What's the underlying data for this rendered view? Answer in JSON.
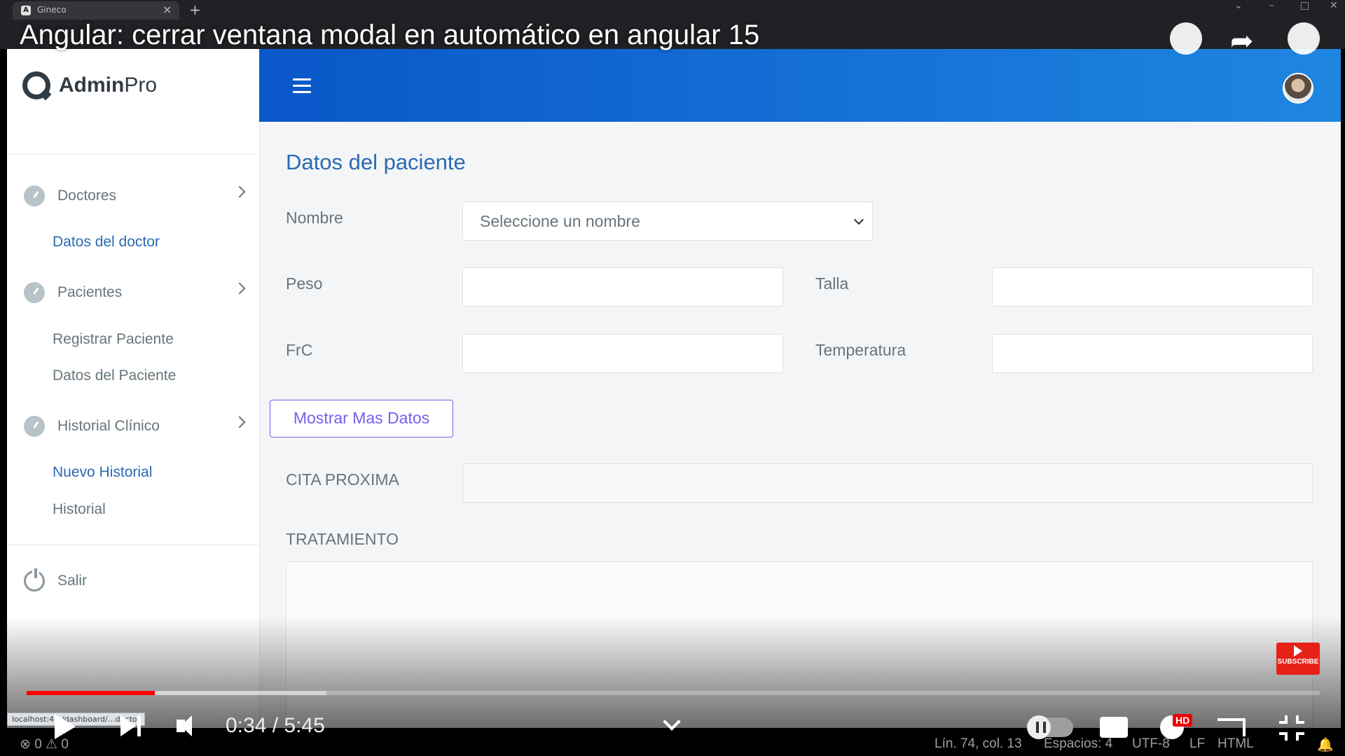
{
  "browser": {
    "tab_title": "Gineco",
    "tab_favicon": "A",
    "tab_close": "×",
    "new_tab": "+"
  },
  "video": {
    "title": "Angular: cerrar ventana modal en automático en angular 15",
    "current_time": "0:34",
    "duration": "5:45",
    "time_display": "0:34 / 5:45",
    "progress_fraction": 0.099,
    "buffer_fraction": 0.232,
    "hd_badge": "HD",
    "subscribe_label": "SUBSCRIBE"
  },
  "app": {
    "logo": {
      "bold": "Admin",
      "light": "Pro"
    },
    "sidebar": {
      "groups": [
        {
          "label": "Doctores",
          "icon": "gauge-icon",
          "children": [
            {
              "label": "Datos del doctor",
              "active": true
            }
          ]
        },
        {
          "label": "Pacientes",
          "icon": "gauge-icon",
          "children": [
            {
              "label": "Registrar Paciente",
              "active": false
            },
            {
              "label": "Datos del Paciente",
              "active": false
            }
          ]
        },
        {
          "label": "Historial Clínico",
          "icon": "gauge-icon",
          "children": [
            {
              "label": "Nuevo Historial",
              "active": true
            },
            {
              "label": "Historial",
              "active": false
            }
          ]
        }
      ],
      "logout_label": "Salir"
    },
    "form": {
      "title": "Datos del paciente",
      "nombre_label": "Nombre",
      "nombre_placeholder": "Seleccione un nombre",
      "peso_label": "Peso",
      "talla_label": "Talla",
      "frc_label": "FrC",
      "temperatura_label": "Temperatura",
      "mostrar_button": "Mostrar Mas Datos",
      "cita_label": "CITA PROXIMA",
      "tratamiento_label": "TRATAMIENTO"
    },
    "accent_color": "#2a6ab1",
    "topbar_color": "#0a57c9"
  },
  "status_url": "localhost:4…/dashboard/…doctor",
  "editor_status": {
    "errors": "0",
    "warnings": "0",
    "position": "Lín. 74, col. 13",
    "indent": "Espacios: 4",
    "encoding": "UTF-8",
    "eol": "LF",
    "language": "HTML"
  }
}
